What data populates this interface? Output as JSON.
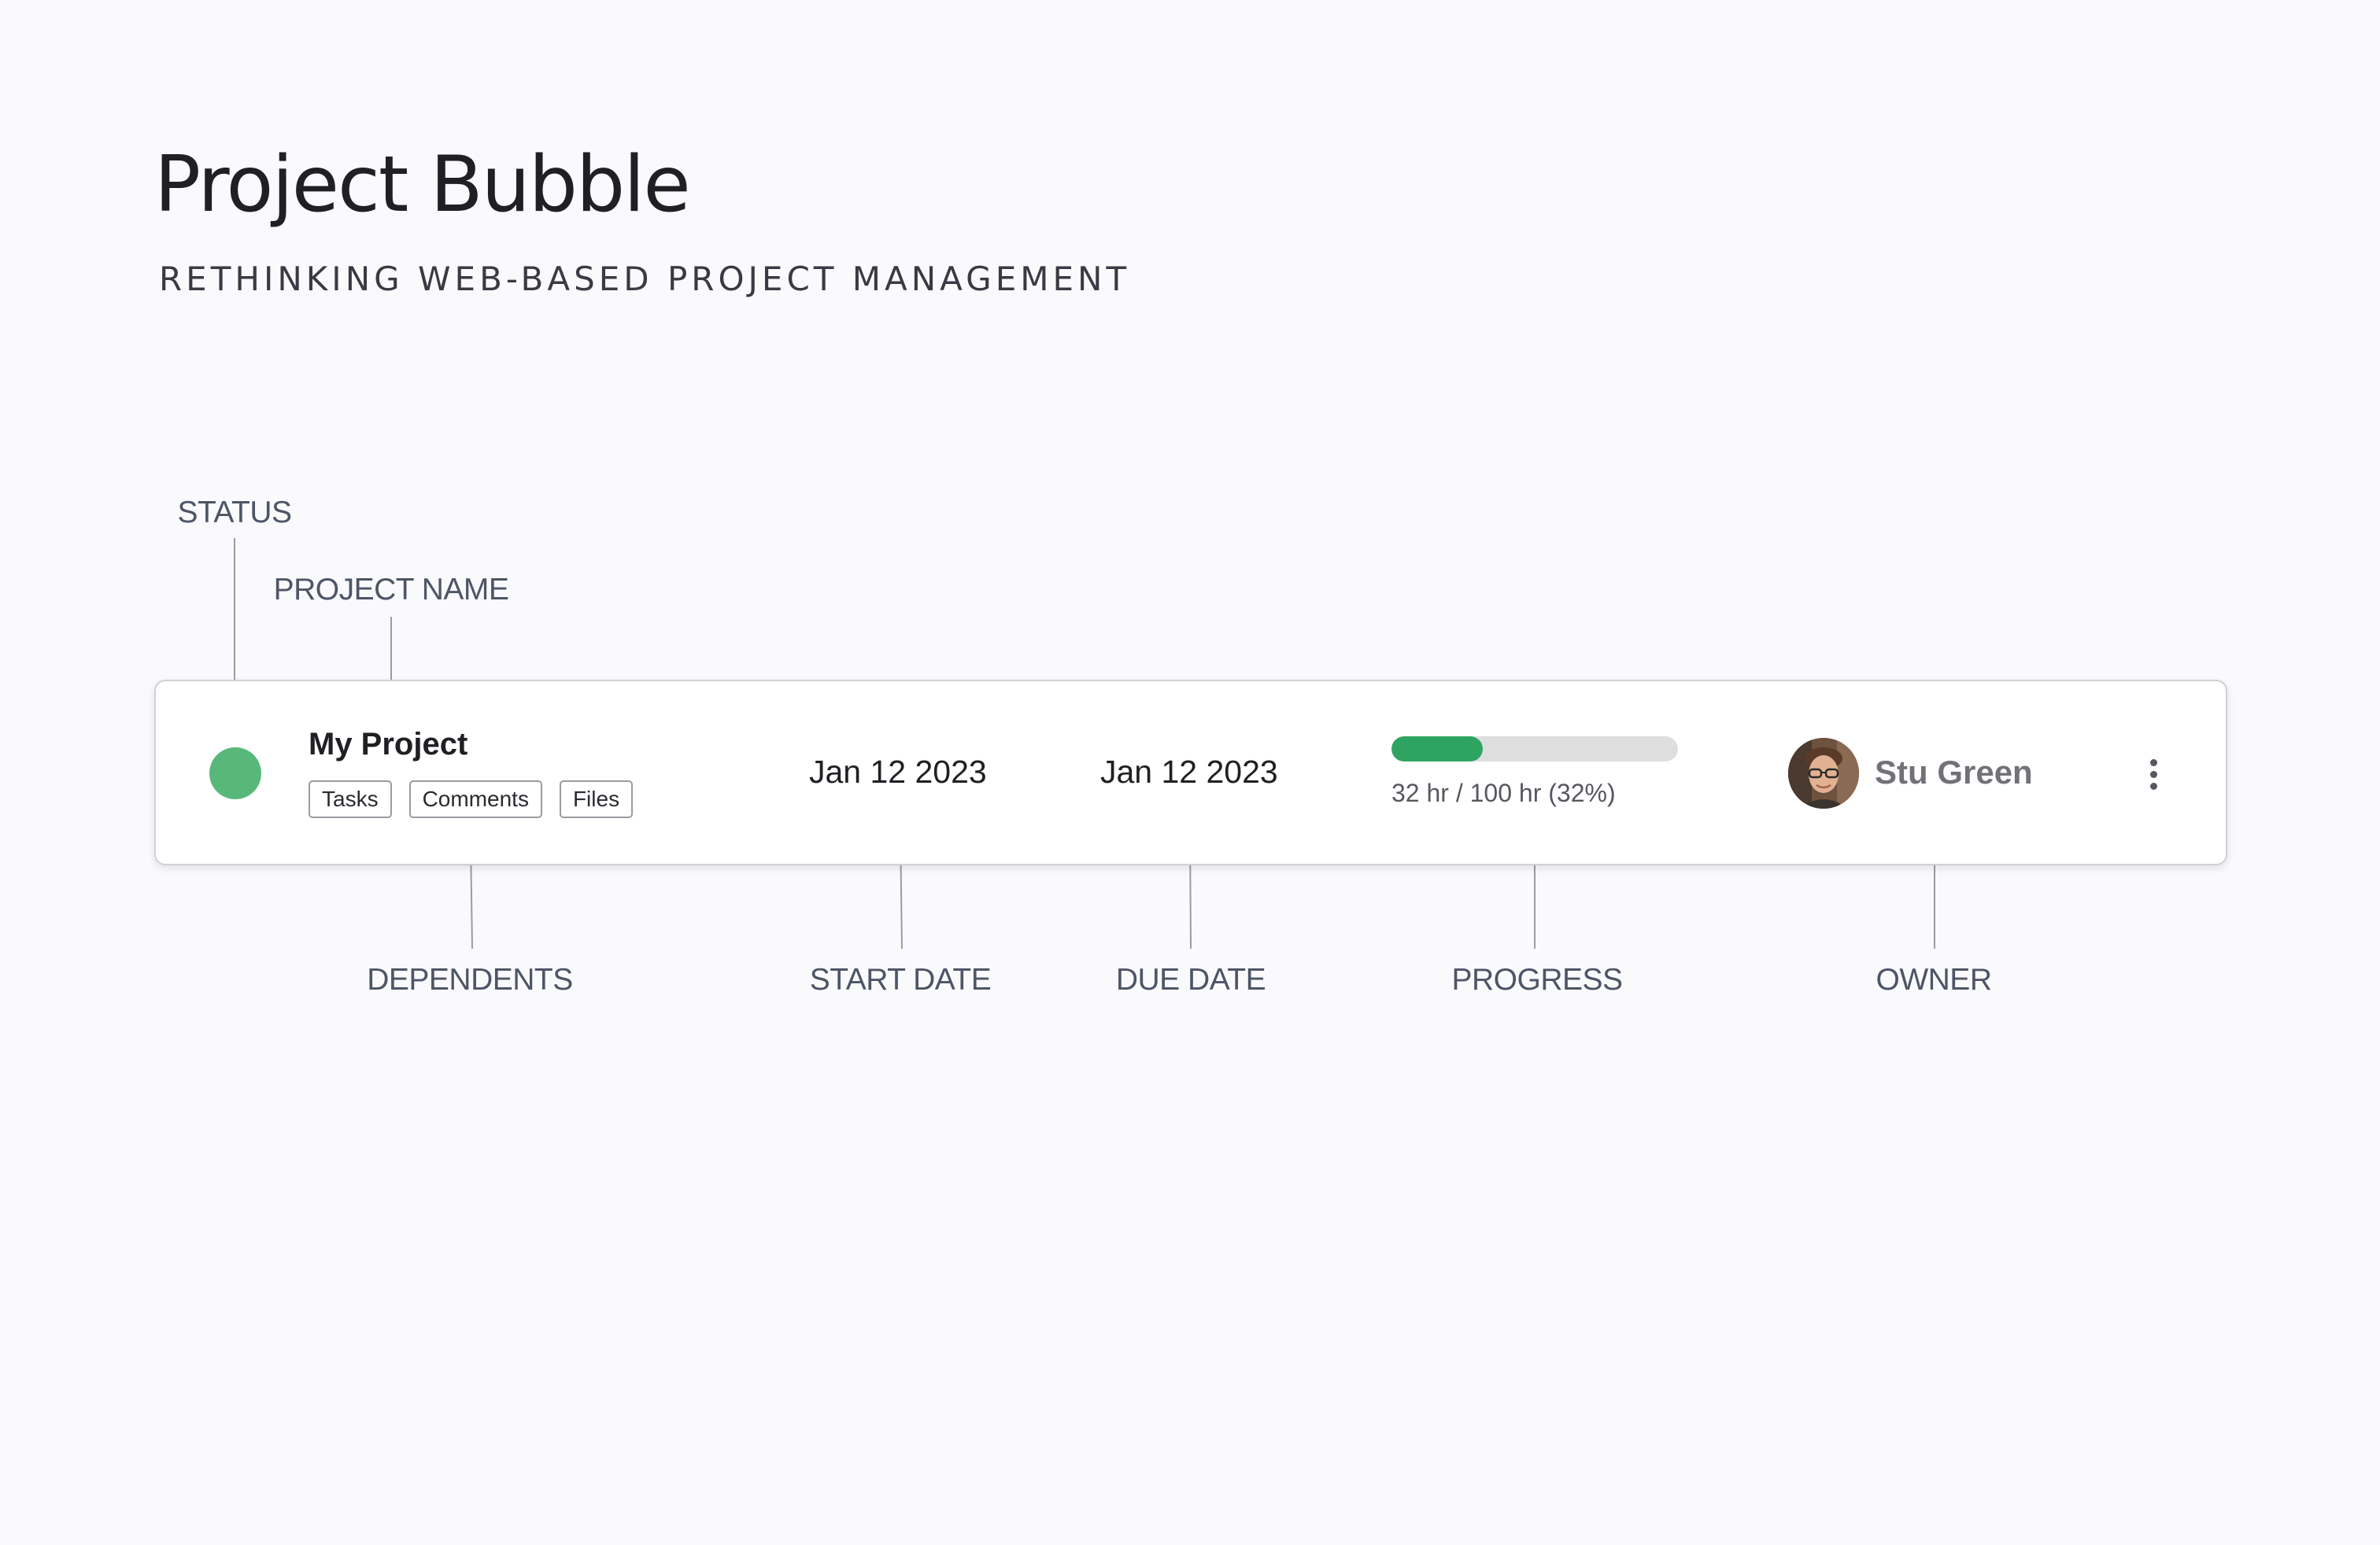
{
  "header": {
    "title": "Project Bubble",
    "subtitle": "RETHINKING WEB-BASED PROJECT MANAGEMENT"
  },
  "annotations": {
    "status": "STATUS",
    "project_name": "PROJECT NAME",
    "dependents": "DEPENDENTS",
    "start_date": "START DATE",
    "due_date": "DUE DATE",
    "progress": "PROGRESS",
    "owner": "OWNER"
  },
  "project": {
    "status_color": "#57b87a",
    "name": "My Project",
    "dependents": [
      "Tasks",
      "Comments",
      "Files"
    ],
    "start_date": "Jan 12 2023",
    "due_date": "Jan 12 2023",
    "progress": {
      "hours_done": 32,
      "hours_total": 100,
      "percent": 32,
      "text": "32 hr / 100 hr (32%)",
      "fill_color": "#2fa462",
      "track_color": "#dedede"
    },
    "owner": {
      "name": "Stu Green",
      "avatar_icon": "user-avatar-photo"
    },
    "menu_icon": "more-vertical-icon"
  }
}
